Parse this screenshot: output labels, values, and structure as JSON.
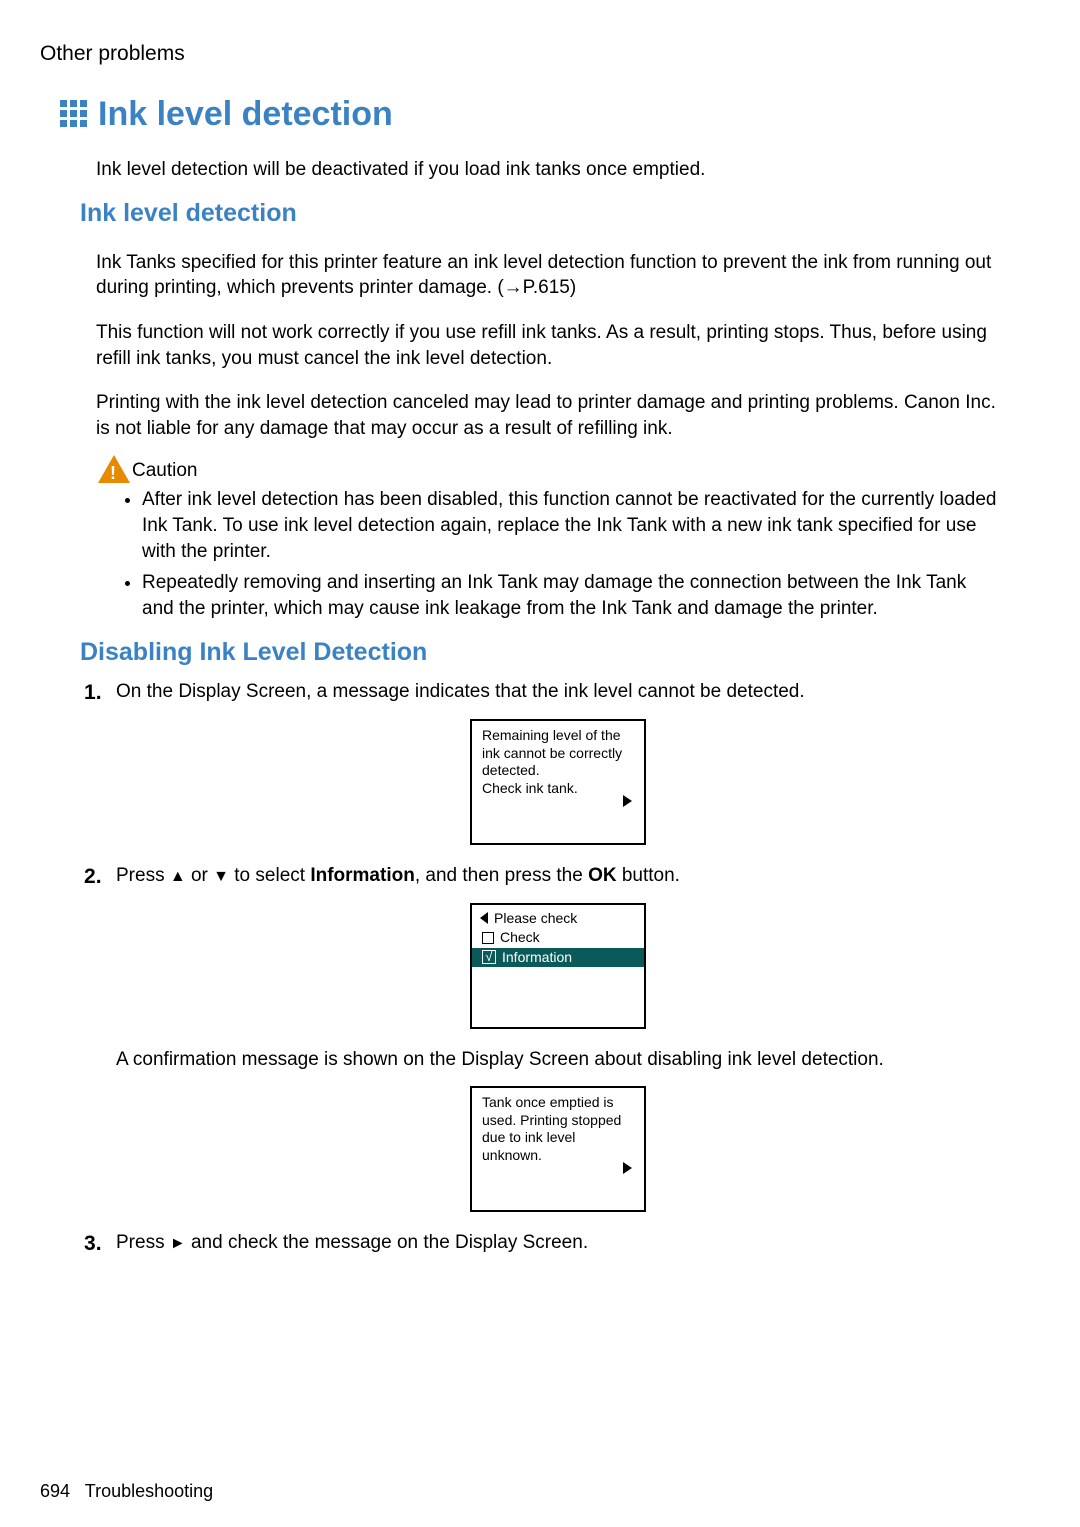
{
  "breadcrumb": "Other problems",
  "page_title": "Ink level detection",
  "intro": "Ink level detection will be deactivated if you load ink tanks once emptied.",
  "section1": {
    "heading": "Ink level detection",
    "p1": "Ink Tanks specified for this printer feature an ink level detection function to prevent the ink from running out during printing, which prevents printer damage.  (→P.615)",
    "p2": "This function will not work correctly if you use refill ink tanks. As a result, printing stops. Thus, before using refill ink tanks, you must cancel the ink level detection.",
    "p3": "Printing with the ink level detection canceled may lead to printer damage and printing problems. Canon Inc. is not liable for any damage that may occur as a result of refilling ink."
  },
  "caution": {
    "label": "Caution",
    "items": [
      "After ink level detection has been disabled, this function cannot be reactivated for the currently loaded Ink Tank. To use ink level detection again, replace the Ink Tank with a new ink tank specified for use with the printer.",
      "Repeatedly removing and inserting an Ink Tank may damage the connection between the Ink Tank and the printer, which may cause ink leakage from the Ink Tank and damage the printer."
    ]
  },
  "section2": {
    "heading": "Disabling Ink Level Detection",
    "step1": {
      "text": "On the Display Screen, a message indicates that the ink level cannot be detected.",
      "screen": "Remaining level of the ink cannot be correctly detected.\nCheck ink tank."
    },
    "step2": {
      "pre": "Press ",
      "sym1": "▲",
      "mid1": " or ",
      "sym2": "▼",
      "mid2": " to select ",
      "bold1": "Information",
      "mid3": ", and then press the ",
      "bold2": "OK",
      "post": " button.",
      "menu": {
        "row1": "Please check",
        "row2": "Check",
        "row3": "Information"
      },
      "after": "A confirmation message is shown on the Display Screen about disabling ink level detection.",
      "screen2": "Tank once emptied is used. Printing stopped due to ink level unknown."
    },
    "step3": {
      "pre": "Press ",
      "sym": "►",
      "post": " and check the message on the Display Screen."
    }
  },
  "footer": {
    "page": "694",
    "section": "Troubleshooting"
  }
}
